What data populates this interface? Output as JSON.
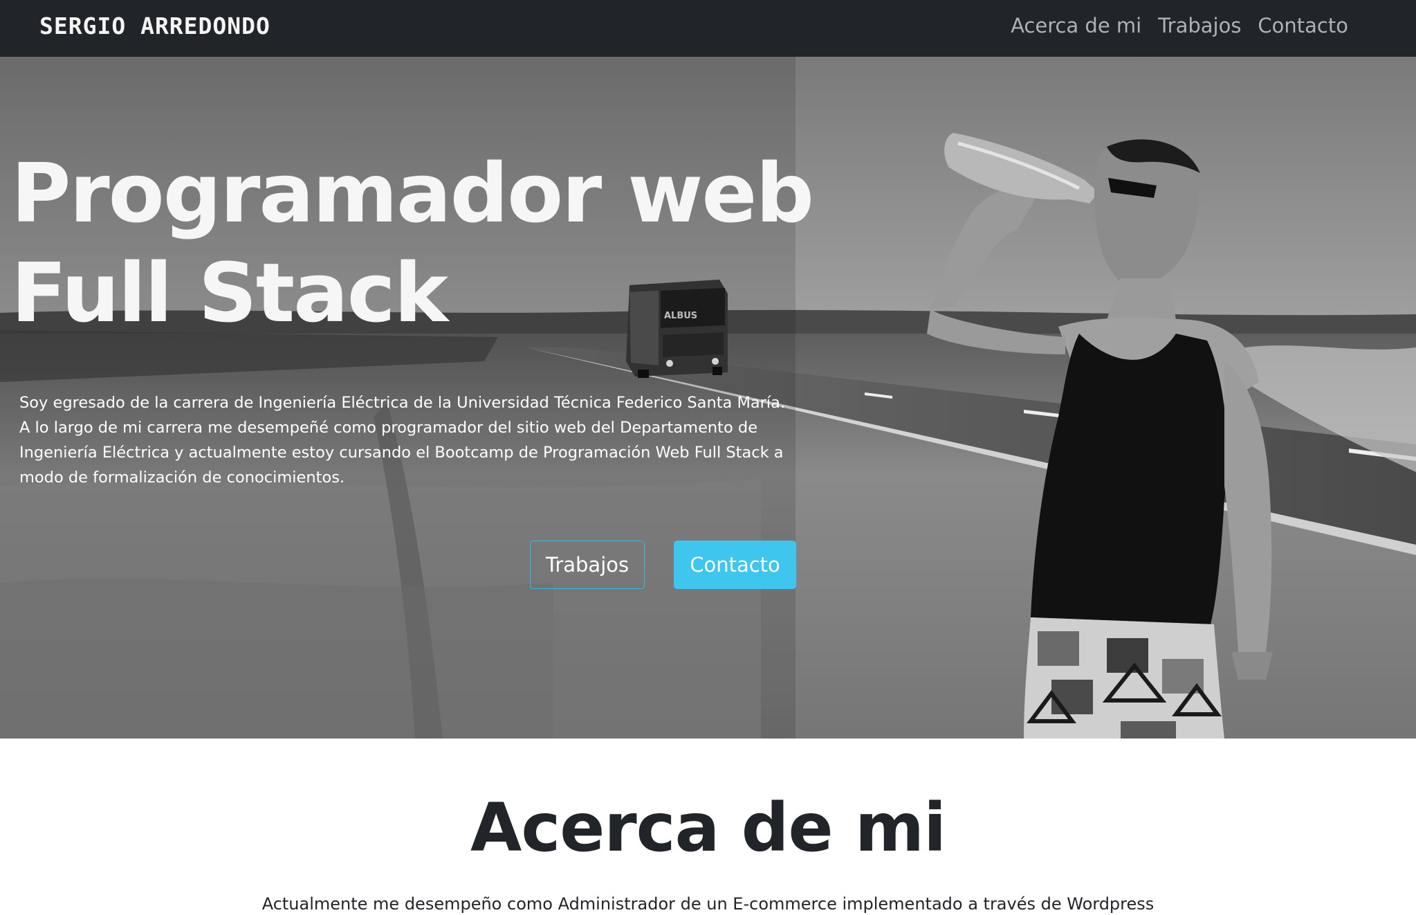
{
  "navbar": {
    "brand": "SERGIO ARREDONDO",
    "links": [
      "Acerca de mi",
      "Trabajos",
      "Contacto"
    ]
  },
  "hero": {
    "title_line1": "Programador web",
    "title_line2": "Full Stack",
    "description": "Soy egresado de la carrera de Ingeniería Eléctrica de la Universidad Técnica Federico Santa María. A lo largo de mi carrera me desempeñé como programador del sitio web del Departamento de Ingeniería Eléctrica y actualmente estoy cursando el Bootcamp de Programación Web Full Stack a modo de formalización de conocimientos.",
    "buttons": {
      "trabajos": "Trabajos",
      "contacto": "Contacto"
    },
    "bus_sign": "ALBUS"
  },
  "about": {
    "title": "Acerca de mi",
    "text": "Actualmente me desempeño como Administrador de un E-commerce implementado a través de Wordpress"
  },
  "colors": {
    "navbar_bg": "#212529",
    "accent": "#3ec6ee",
    "text_dark": "#212529"
  }
}
